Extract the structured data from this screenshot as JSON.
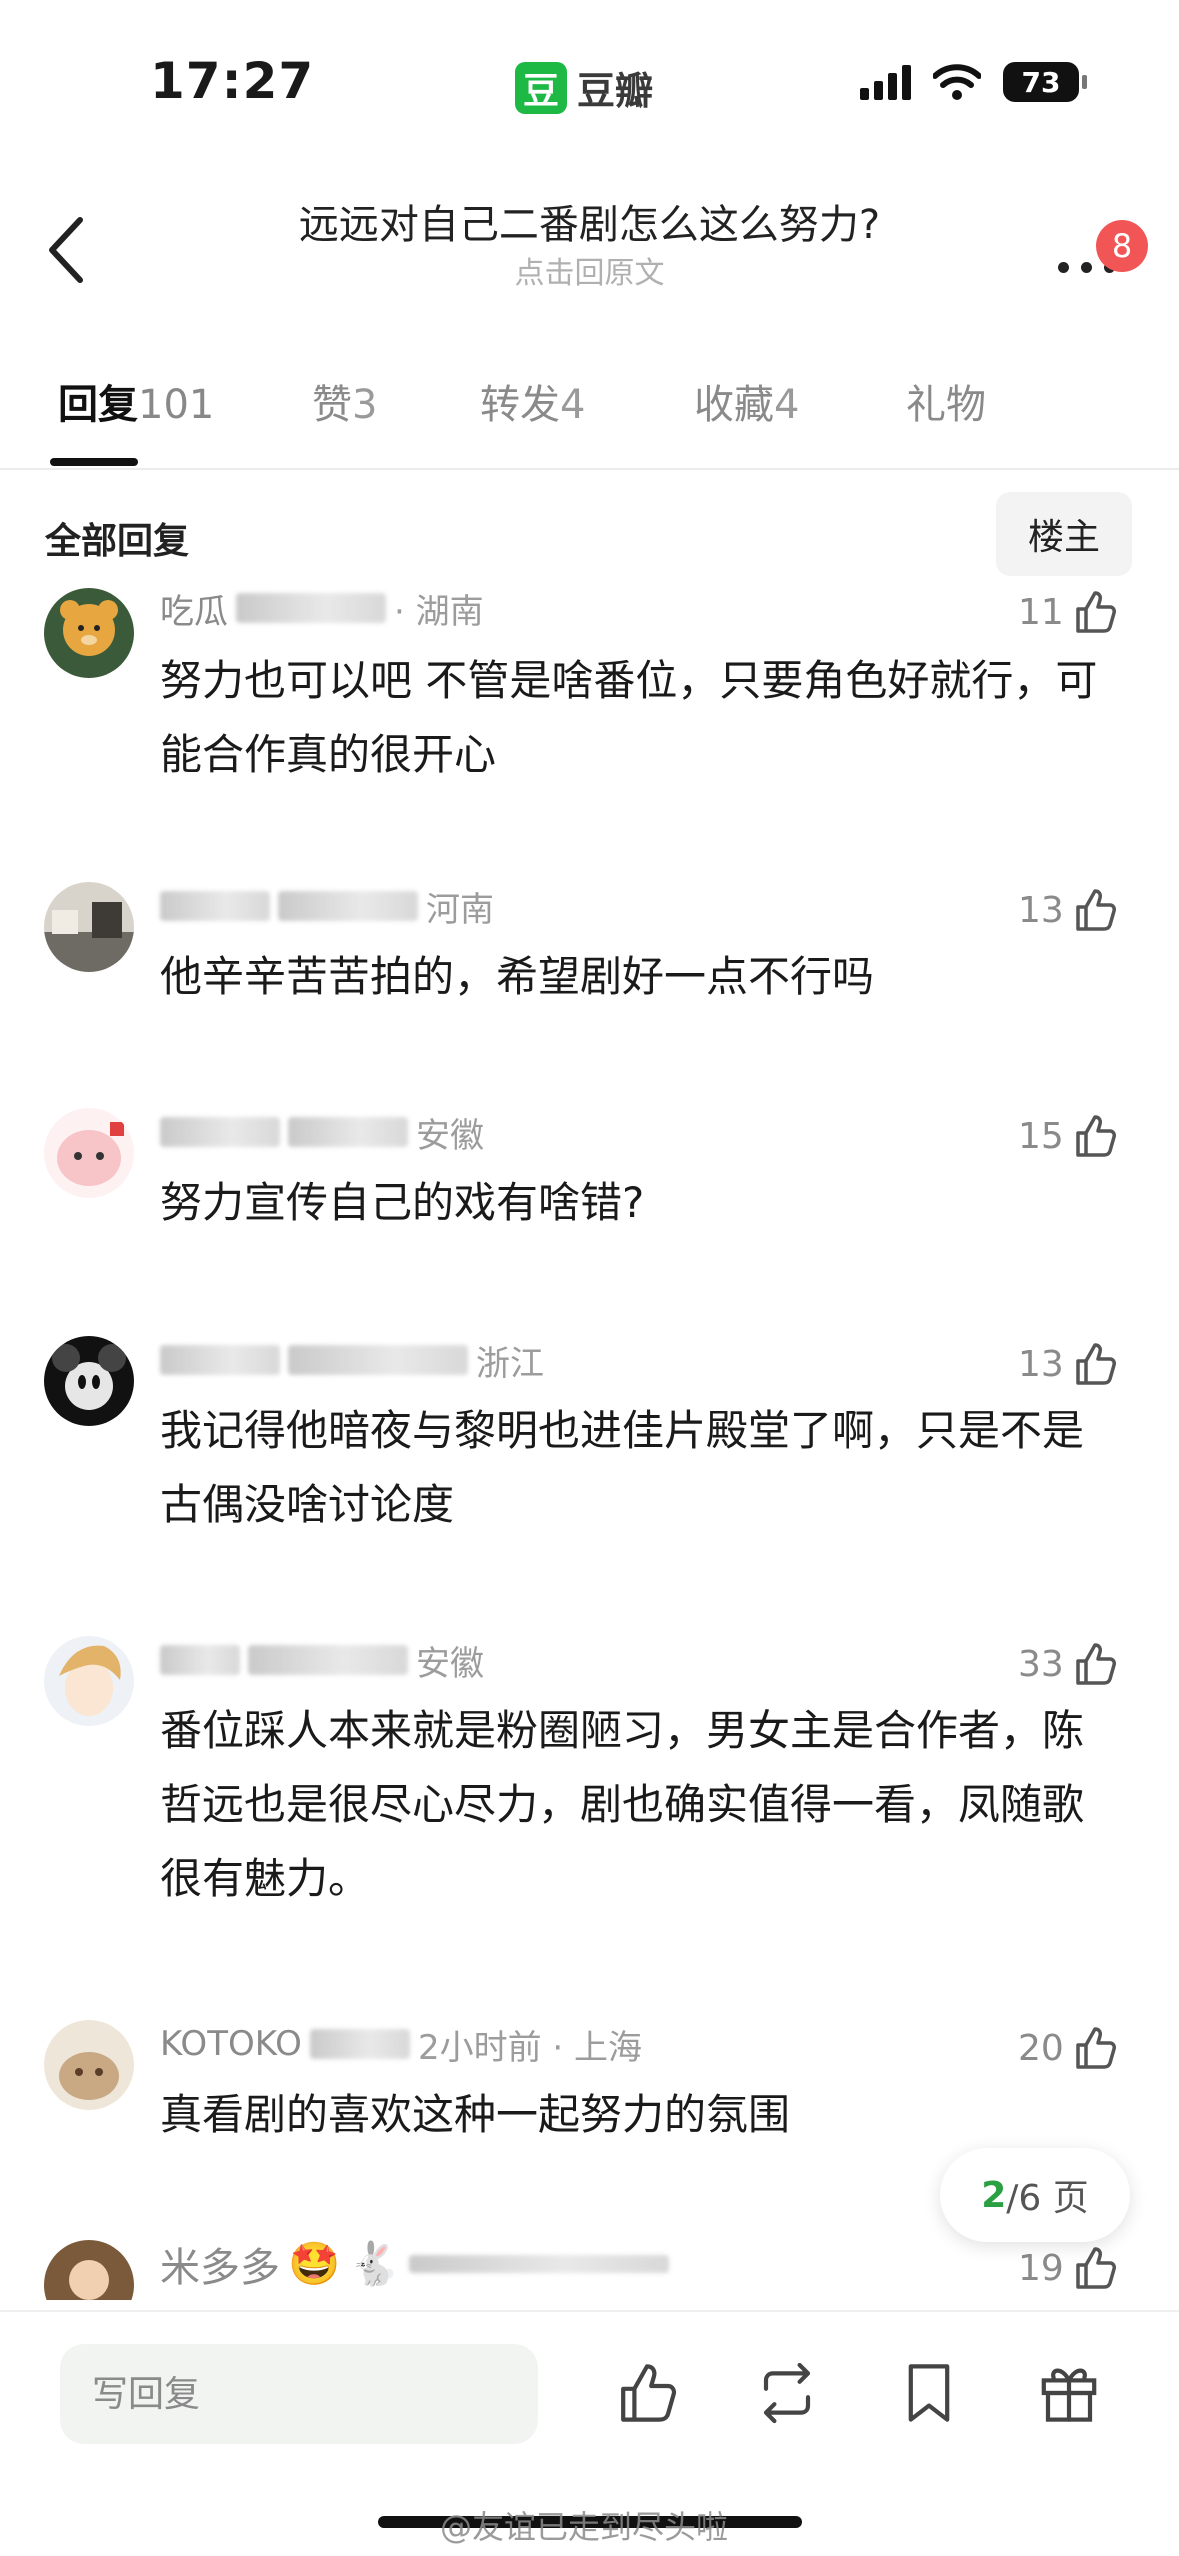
{
  "status_bar": {
    "time": "17:27",
    "app_logo_text": "豆",
    "app_name": "豆瓣",
    "battery": "73"
  },
  "nav": {
    "title": "远远对自己二番剧怎么这么努力?",
    "subtitle": "点击回原文",
    "notif_count": "8"
  },
  "tabs": [
    {
      "label": "回复",
      "count": "101",
      "active": true
    },
    {
      "label": "赞",
      "count": "3"
    },
    {
      "label": "转发",
      "count": "4"
    },
    {
      "label": "收藏",
      "count": "4"
    },
    {
      "label": "礼物",
      "count": ""
    }
  ],
  "filter": {
    "all_label": "全部回复",
    "author_label": "楼主"
  },
  "comments": [
    {
      "name": "吃瓜",
      "time_location": "· 湖南",
      "text": "努力也可以吧  不管是啥番位，只要角色好就行，可能合作真的很开心",
      "likes": "11",
      "avatar_color": "#e8a640"
    },
    {
      "name": "",
      "time_location": "河南",
      "text": "他辛辛苦苦拍的，希望剧好一点不行吗",
      "likes": "13",
      "avatar_color": "#6e6a64"
    },
    {
      "name": "",
      "time_location": "安徽",
      "text": "努力宣传自己的戏有啥错?",
      "likes": "15",
      "avatar_color": "#f7c4c8"
    },
    {
      "name": "",
      "time_location": "浙江",
      "text": "我记得他暗夜与黎明也进佳片殿堂了啊，只是不是古偶没啥讨论度",
      "likes": "13",
      "avatar_color": "#222222"
    },
    {
      "name": "",
      "time_location": "安徽",
      "text": "番位踩人本来就是粉圈陋习，男女主是合作者，陈哲远也是很尽心尽力，剧也确实值得一看，凤随歌很有魅力。",
      "likes": "33",
      "avatar_color": "#f1d9a8"
    },
    {
      "name": "KOTOKO",
      "time_location": "2小时前 · 上海",
      "text": "真看剧的喜欢这种一起努力的氛围",
      "likes": "20",
      "avatar_color": "#c9a884"
    },
    {
      "name": "米多多",
      "time_location": "",
      "text": "",
      "likes": "19",
      "avatar_color": "#7a5a3a"
    }
  ],
  "page_indicator": {
    "current": "2",
    "total": "/6 页"
  },
  "bottom_bar": {
    "reply_placeholder": "写回复"
  },
  "watermark": "@友谊已走到尽头啦",
  "icons": [
    "back-arrow-icon",
    "more-icon",
    "thumbs-up-icon",
    "repost-icon",
    "bookmark-icon",
    "gift-icon"
  ],
  "colors": {
    "brand_green": "#1eb845",
    "badge_red": "#f25555",
    "page_green": "#2aa043"
  }
}
